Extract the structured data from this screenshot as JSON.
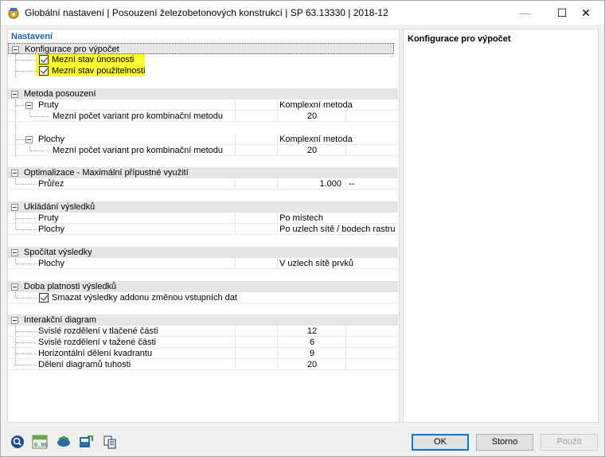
{
  "window": {
    "title": "Globální nastavení | Posouzení železobetonových konstrukcí | SP 63.13330 | 2018-12",
    "minimize": "—",
    "maximize": "☐",
    "close": "✕"
  },
  "left": {
    "header": "Nastavení",
    "konfigurace": {
      "title": "Konfigurace pro výpočet",
      "item1": "Mezní stav únosnosti",
      "item2": "Mezní stav použitelnosti"
    },
    "metoda": {
      "title": "Metoda posouzení",
      "pruty_label": "Pruty",
      "pruty_value": "Komplexní metoda",
      "pruty_count_label": "Mezní počet variant pro kombinační metodu",
      "pruty_count_value": "20",
      "plochy_label": "Plochy",
      "plochy_value": "Komplexní metoda",
      "plochy_count_label": "Mezní počet variant pro kombinační metodu",
      "plochy_count_value": "20"
    },
    "optimalizace": {
      "title": "Optimalizace - Maximální přípustné využití",
      "prurez_label": "Průřez",
      "prurez_value": "1.000",
      "prurez_unit": "--"
    },
    "ukladani": {
      "title": "Ukládání výsledků",
      "pruty_label": "Pruty",
      "pruty_value": "Po místech",
      "plochy_label": "Plochy",
      "plochy_value": "Po uzlech sítě / bodech rastru"
    },
    "spocitat": {
      "title": "Spočítat výsledky",
      "plochy_label": "Plochy",
      "plochy_value": "V uzlech sítě prvků"
    },
    "doba": {
      "title": "Doba platnosti výsledků",
      "item": "Smazat výsledky addonu změnou vstupních dat"
    },
    "interakcni": {
      "title": "Interakční diagram",
      "rows": [
        {
          "label": "Svislé rozdělení v tlačené části",
          "value": "12"
        },
        {
          "label": "Svislé rozdělení v tažené části",
          "value": "6"
        },
        {
          "label": "Horizontální dělení kvadrantu",
          "value": "9"
        },
        {
          "label": "Dělení diagramů tuhosti",
          "value": "20"
        }
      ]
    }
  },
  "right": {
    "title": "Konfigurace pro výpočet"
  },
  "buttons": {
    "ok": "OK",
    "storno": "Storno",
    "pouzit": "Použít"
  }
}
